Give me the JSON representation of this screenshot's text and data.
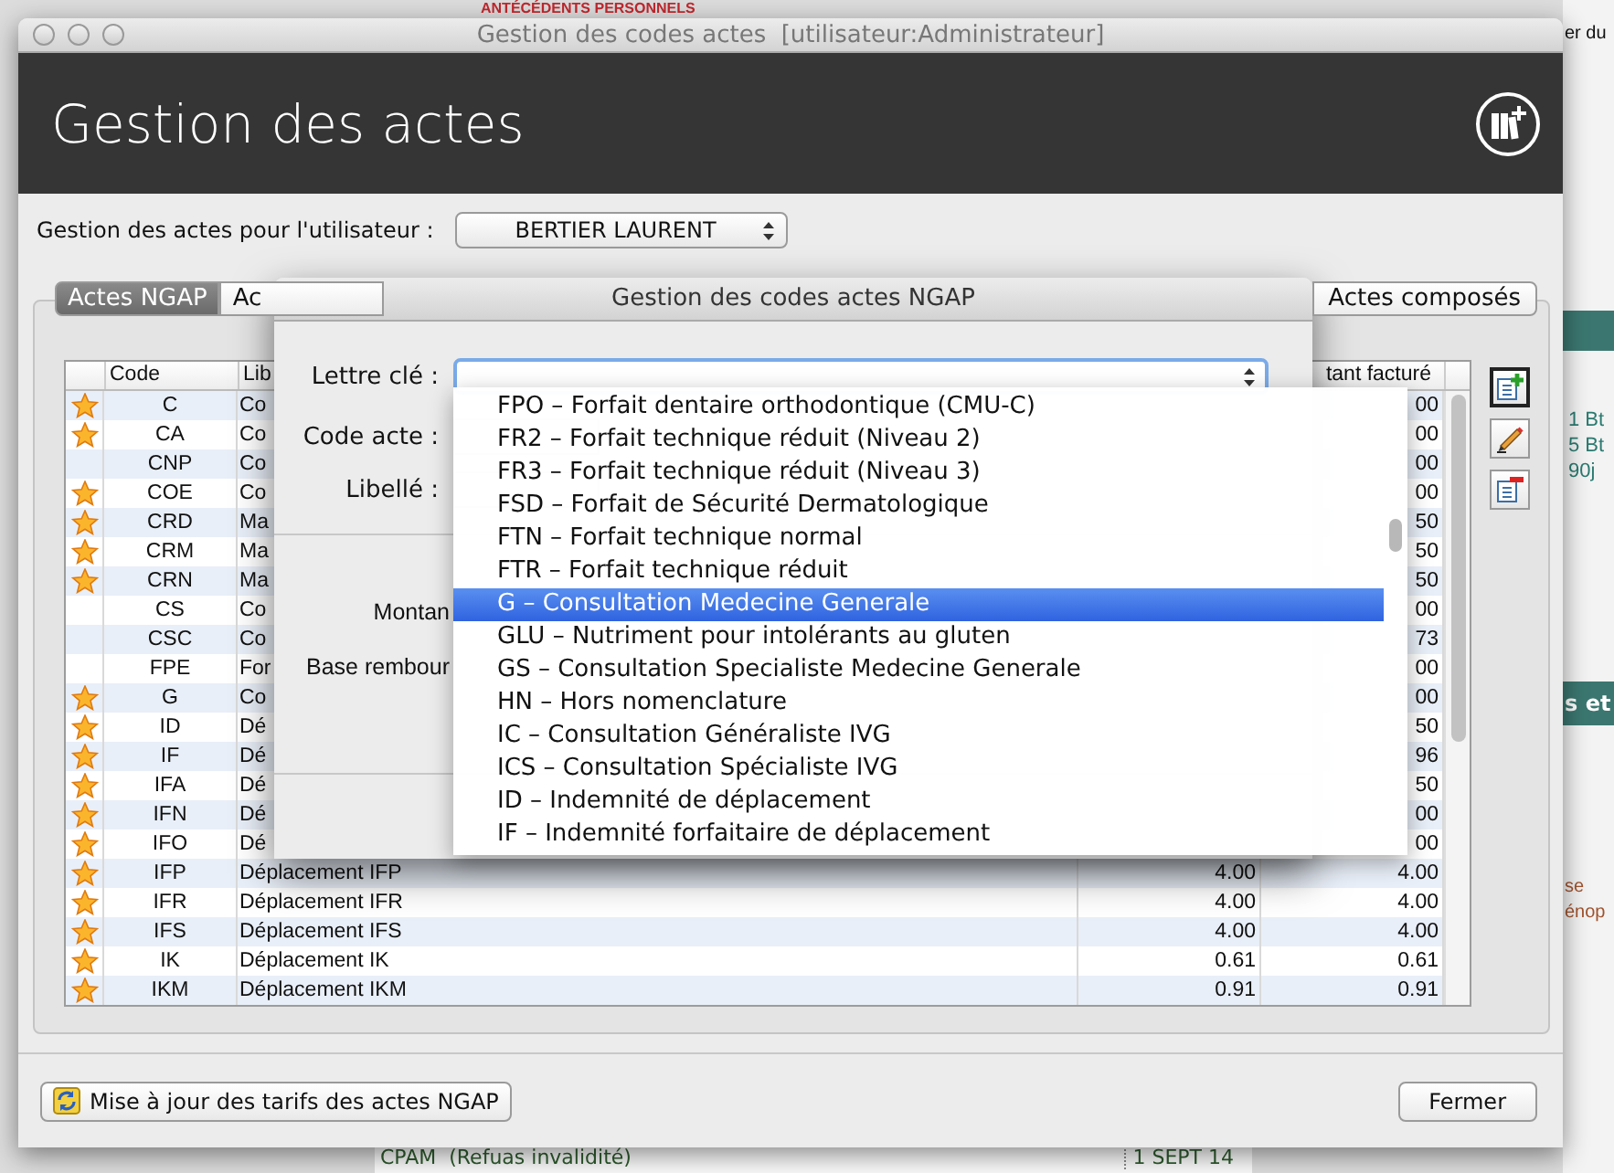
{
  "background": {
    "heading": "ANTÉCÉDENTS PERSONNELS",
    "side_top": "er du",
    "side_notes": [
      "1 Bt",
      "5 Bt",
      "90j"
    ],
    "side_bar": "s et",
    "side_lower": [
      "se",
      "énop"
    ],
    "bottom_row": {
      "label": "CPAM  (Refuas invalidité)",
      "date": "1 SEPT 14"
    }
  },
  "main_window": {
    "title": "Gestion des codes actes  [utilisateur:Administrateur]",
    "heading": "Gestion des actes",
    "user_label": "Gestion des actes pour l'utilisateur :",
    "user_select": "BERTIER LAURENT",
    "tabs": [
      {
        "label": "Actes NGAP",
        "selected": true
      },
      {
        "label": "Ac",
        "selected": false
      },
      {
        "label": "Actes composés",
        "selected": false
      }
    ],
    "table": {
      "columns": [
        "Code",
        "Lib",
        "tant facturé"
      ],
      "rows": [
        {
          "favorite": true,
          "code": "C",
          "label": "Co",
          "billed": "00"
        },
        {
          "favorite": true,
          "code": "CA",
          "label": "Co",
          "billed": "00"
        },
        {
          "favorite": false,
          "code": "CNP",
          "label": "Co",
          "billed": "00"
        },
        {
          "favorite": true,
          "code": "COE",
          "label": "Co",
          "billed": "00"
        },
        {
          "favorite": true,
          "code": "CRD",
          "label": "Ma",
          "billed": "50"
        },
        {
          "favorite": true,
          "code": "CRM",
          "label": "Ma",
          "billed": "50"
        },
        {
          "favorite": true,
          "code": "CRN",
          "label": "Ma",
          "billed": "50"
        },
        {
          "favorite": false,
          "code": "CS",
          "label": "Co",
          "billed": "00"
        },
        {
          "favorite": false,
          "code": "CSC",
          "label": "Co",
          "billed": "73"
        },
        {
          "favorite": false,
          "code": "FPE",
          "label": "For",
          "billed": "00"
        },
        {
          "favorite": true,
          "code": "G",
          "label": "Co",
          "billed": "00"
        },
        {
          "favorite": true,
          "code": "ID",
          "label": "Dé",
          "billed": "50"
        },
        {
          "favorite": true,
          "code": "IF",
          "label": "Dé",
          "billed": "96"
        },
        {
          "favorite": true,
          "code": "IFA",
          "label": "Dé",
          "billed": "50"
        },
        {
          "favorite": true,
          "code": "IFN",
          "label": "Dé",
          "billed": "00"
        },
        {
          "favorite": true,
          "code": "IFO",
          "label": "Dé",
          "billed": "00"
        },
        {
          "favorite": true,
          "code": "IFP",
          "label": "Déplacement IFP",
          "amount": "4.00",
          "billed": "4.00"
        },
        {
          "favorite": true,
          "code": "IFR",
          "label": "Déplacement IFR",
          "amount": "4.00",
          "billed": "4.00"
        },
        {
          "favorite": true,
          "code": "IFS",
          "label": "Déplacement IFS",
          "amount": "4.00",
          "billed": "4.00"
        },
        {
          "favorite": true,
          "code": "IK",
          "label": "Déplacement IK",
          "amount": "0.61",
          "billed": "0.61"
        },
        {
          "favorite": true,
          "code": "IKM",
          "label": "Déplacement IKM",
          "amount": "0.91",
          "billed": "0.91"
        }
      ]
    },
    "update_button": "Mise à jour des tarifs des actes NGAP",
    "close_button": "Fermer"
  },
  "dialog": {
    "title": "Gestion des codes actes NGAP",
    "labels": [
      "Lettre clé :",
      "Code acte :",
      "Libellé :"
    ],
    "partial_labels": [
      "Montan",
      "Base rembour"
    ],
    "options": [
      {
        "label": "FPO – Forfait dentaire orthodontique (CMU-C)",
        "selected": false
      },
      {
        "label": "FR2 – Forfait technique réduit (Niveau 2)",
        "selected": false
      },
      {
        "label": "FR3 – Forfait technique réduit (Niveau 3)",
        "selected": false
      },
      {
        "label": "FSD – Forfait de Sécurité Dermatologique",
        "selected": false
      },
      {
        "label": "FTN – Forfait technique normal",
        "selected": false
      },
      {
        "label": "FTR – Forfait technique réduit",
        "selected": false
      },
      {
        "label": "G – Consultation Medecine Generale",
        "selected": true
      },
      {
        "label": "GLU – Nutriment pour intolérants au gluten",
        "selected": false
      },
      {
        "label": "GS – Consultation Specialiste Medecine Generale",
        "selected": false
      },
      {
        "label": "HN – Hors nomenclature",
        "selected": false
      },
      {
        "label": "IC – Consultation Généraliste IVG",
        "selected": false
      },
      {
        "label": "ICS – Consultation Spécialiste IVG",
        "selected": false
      },
      {
        "label": "ID – Indemnité de déplacement",
        "selected": false
      },
      {
        "label": "IF – Indemnité forfaitaire de déplacement",
        "selected": false
      }
    ]
  }
}
